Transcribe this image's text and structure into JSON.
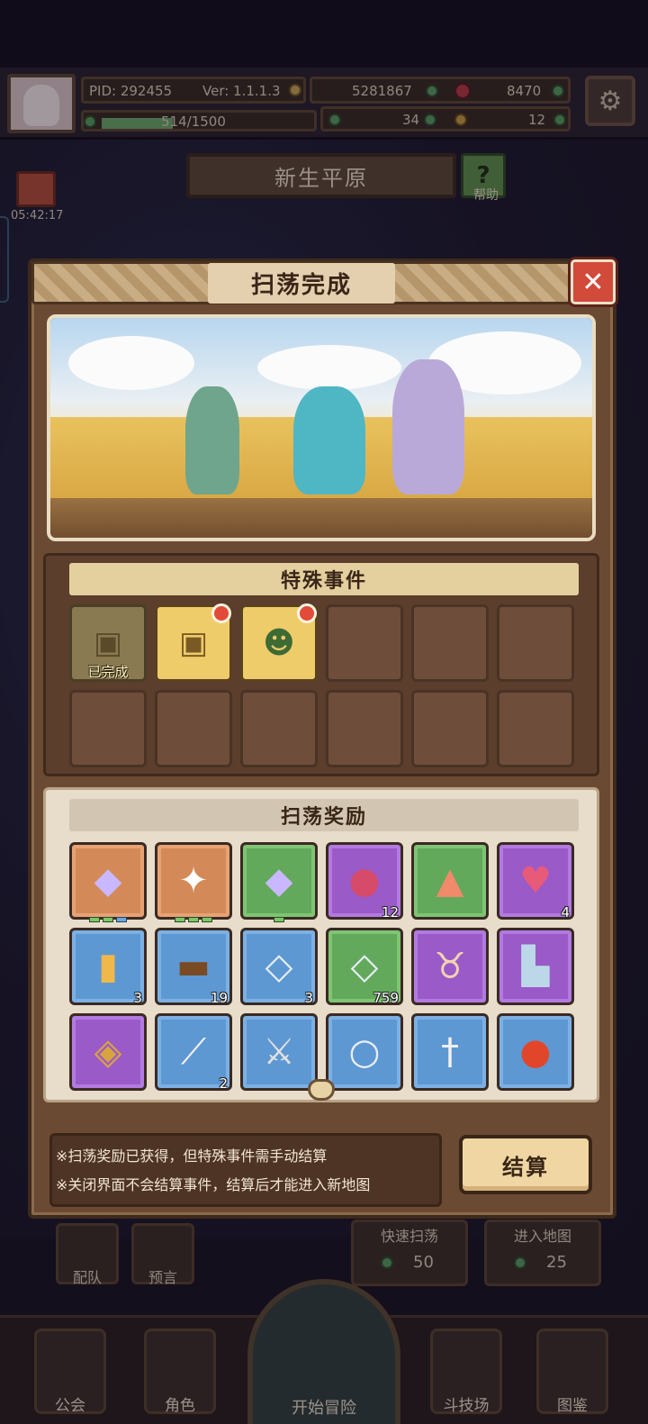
{
  "hud": {
    "pid": "PID: 292455",
    "version": "Ver: 1.1.1.3",
    "gold": "5281867",
    "gems": "8470",
    "clover": "34",
    "keys": "12",
    "xp": "514/1500",
    "xp_fraction": 0.343
  },
  "map": {
    "name": "新生平原",
    "help_label": "帮助",
    "gift_timer": "05:42:17"
  },
  "modal": {
    "title": "扫荡完成",
    "close_icon": "close-icon",
    "special_events": {
      "heading": "特殊事件",
      "completed_caption": "已完成"
    },
    "rewards": {
      "heading": "扫荡奖励",
      "items": [
        {
          "icon": "purple-gem-icon",
          "rarity": "orange",
          "qty": ""
        },
        {
          "icon": "white-gem-icon",
          "rarity": "orange",
          "qty": ""
        },
        {
          "icon": "purple-gem-icon",
          "rarity": "green",
          "qty": ""
        },
        {
          "icon": "berry-icon",
          "rarity": "purple",
          "qty": "12"
        },
        {
          "icon": "slime-icon",
          "rarity": "green",
          "qty": ""
        },
        {
          "icon": "heart-fruit-icon",
          "rarity": "purple",
          "qty": "4"
        },
        {
          "icon": "jar-icon",
          "rarity": "blue",
          "qty": "3"
        },
        {
          "icon": "log-icon",
          "rarity": "blue",
          "qty": "19"
        },
        {
          "icon": "crystal-icon",
          "rarity": "blue",
          "qty": "3"
        },
        {
          "icon": "crystal-icon",
          "rarity": "green",
          "qty": "759"
        },
        {
          "icon": "bull-head-icon",
          "rarity": "purple",
          "qty": ""
        },
        {
          "icon": "boots-icon",
          "rarity": "purple",
          "qty": ""
        },
        {
          "icon": "amulet-icon",
          "rarity": "purple",
          "qty": ""
        },
        {
          "icon": "wand-icon",
          "rarity": "blue",
          "qty": "2"
        },
        {
          "icon": "sword-icon",
          "rarity": "blue",
          "qty": ""
        },
        {
          "icon": "orb-icon",
          "rarity": "blue",
          "qty": ""
        },
        {
          "icon": "dagger-icon",
          "rarity": "blue",
          "qty": ""
        },
        {
          "icon": "fire-orb-icon",
          "rarity": "blue",
          "qty": ""
        }
      ]
    },
    "notes": [
      "※扫荡奖励已获得，但特殊事件需手动结算",
      "※关闭界面不会结算事件，结算后才能进入新地图"
    ],
    "settle_button": "结算"
  },
  "background_buttons": {
    "team": "配队",
    "forecast": "预言",
    "quick_sweep": "快速扫荡",
    "quick_sweep_cost": "50",
    "enter_map": "进入地图",
    "enter_map_cost": "25"
  },
  "nav": [
    "公会",
    "角色",
    "开始冒险",
    "斗技场",
    "图鉴"
  ],
  "colors": {
    "orange_slot": "#d38a58",
    "green_slot": "#62a95c",
    "purple_slot": "#9a5ac8",
    "blue_slot": "#5e98d2",
    "close_red": "#d24a3a"
  }
}
